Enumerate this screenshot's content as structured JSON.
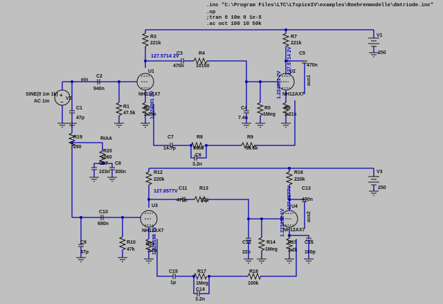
{
  "directives": [
    ".inc \"C:\\Program Files\\LTC\\LTspiceIV\\examples\\Roehrenmodelle\\dmtriode.inc\"",
    ".op",
    ";tran 0 10m 0 1e-5",
    ".ac oct 100 10 50k"
  ],
  "stage1": {
    "R3": {
      "name": "R3",
      "value": "221k"
    },
    "C3": {
      "name": "C3",
      "value": "470n"
    },
    "R4": {
      "name": "R4",
      "value": "10150"
    },
    "C2": {
      "name": "C2",
      "value": "940n"
    },
    "R1": {
      "name": "R1",
      "value": "47.5k"
    },
    "R2": {
      "name": "R2",
      "value": "2.21k"
    },
    "U1": {
      "name": "U1",
      "model": "NH12AX7"
    },
    "C1": {
      "name": "C1",
      "value": "47p"
    },
    "C4": {
      "name": "C4",
      "value": "7.4n"
    },
    "R5": {
      "name": "R5",
      "value": "1Meg"
    },
    "V2": {
      "name": "V2",
      "line1": "SINE(0 1m 1k)",
      "line2": "AC 1m"
    },
    "anode_voltage": "127.5714 2V",
    "cathode_voltage": "1.224001 2V",
    "ein": "ein"
  },
  "stage2": {
    "R7": {
      "name": "R7",
      "value": "221k"
    },
    "C5": {
      "name": "C5",
      "value": "470n"
    },
    "U2": {
      "name": "U2",
      "model": "NH12AX7"
    },
    "R6": {
      "name": "R6",
      "value": "2.21k"
    },
    "anode_voltage": "127.5714 2V",
    "cathode_voltage": "1.224001 2V",
    "aus1": "aus1",
    "V1": {
      "name": "V1",
      "value": "250"
    }
  },
  "feedback1": {
    "C7": {
      "name": "C7",
      "value": "14.7p"
    },
    "R8": {
      "name": "R8",
      "value": "995k"
    },
    "C6": {
      "name": "C6",
      "value": "3.2n"
    },
    "R9": {
      "name": "R9",
      "value": "99.6k"
    },
    "R19": {
      "name": "R19",
      "value": "7290"
    },
    "RIAA": "RIAA",
    "R20": {
      "name": "R20",
      "value": "1060"
    },
    "C17": {
      "name": "C17",
      "value": "103n"
    },
    "C8": {
      "name": "C8",
      "value": "300n"
    }
  },
  "stage3": {
    "R12": {
      "name": "R12",
      "value": "220k"
    },
    "C11": {
      "name": "C11",
      "value": "470n"
    },
    "R13": {
      "name": "R13",
      "value": "22k"
    },
    "C10": {
      "name": "C10",
      "value": "680n"
    },
    "C9": {
      "name": "C9",
      "value": "47p"
    },
    "R10": {
      "name": "R10",
      "value": "47k"
    },
    "R11": {
      "name": "R11",
      "value": "2.2k"
    },
    "U3": {
      "name": "U3",
      "model": "NH12AX7"
    },
    "C12": {
      "name": "C12",
      "value": "22n"
    },
    "R14": {
      "name": "R14",
      "value": "1Meg"
    },
    "anode_voltage": "127.6577V",
    "cathode_voltage": "1.223198 1V"
  },
  "stage4": {
    "R16": {
      "name": "R16",
      "value": "220k"
    },
    "C13": {
      "name": "C13",
      "value": "470n"
    },
    "U4": {
      "name": "U4",
      "model": "NH12AX7"
    },
    "R15": {
      "name": "R15",
      "value": "2.2k"
    },
    "C16": {
      "name": "C16",
      "value": "100p"
    },
    "anode_voltage": "127.6577V",
    "cathode_voltage": "1.223198 1V",
    "aus2": "aus2",
    "V3": {
      "name": "V3",
      "value": "250"
    }
  },
  "feedback2": {
    "C15": {
      "name": "C15",
      "value": "1p"
    },
    "R17": {
      "name": "R17",
      "value": "1Meg"
    },
    "C14": {
      "name": "C14",
      "value": "3.2n"
    },
    "R18": {
      "name": "R18",
      "value": "100k"
    }
  }
}
